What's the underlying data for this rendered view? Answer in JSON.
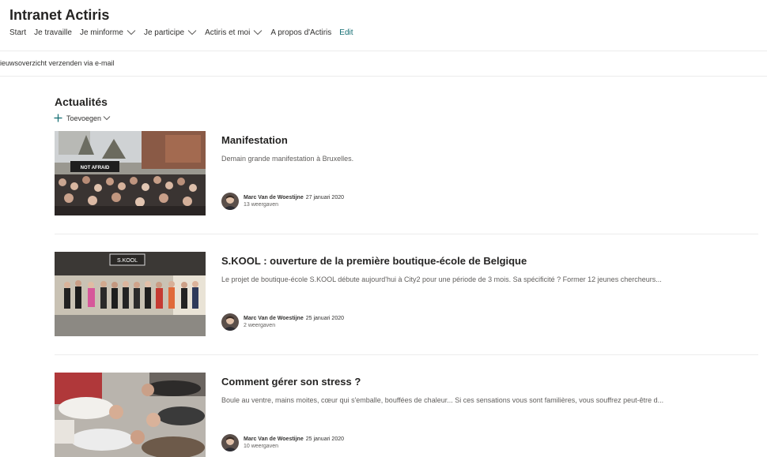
{
  "site": {
    "title": "Intranet Actiris"
  },
  "nav": {
    "items": [
      {
        "label": "Start"
      },
      {
        "label": "Je travaille"
      },
      {
        "label": "Je minforme"
      },
      {
        "label": "Je participe"
      },
      {
        "label": "Actiris et moi"
      },
      {
        "label": "A propos d'Actiris"
      }
    ],
    "edit_label": "Edit"
  },
  "commandbar": {
    "email_label": "ieuwsoverzicht verzenden via e-mail"
  },
  "news_section": {
    "title": "Actualités",
    "add_label": "Toevoegen",
    "items": [
      {
        "title": "Manifestation",
        "description": "Demain grande manifestation à Bruxelles.",
        "author": "Marc Van de Woestijne",
        "date": "27 januari 2020",
        "views": "13 weergaven",
        "image_text": "NOT AFRAID"
      },
      {
        "title": "S.KOOL : ouverture de la première boutique-école de Belgique",
        "description": "Le projet de boutique-école S.KOOL débute aujourd'hui à City2 pour une période de 3 mois. Sa spécificité ? Former 12 jeunes chercheurs...",
        "author": "Marc Van de Woestijne",
        "date": "25 januari 2020",
        "views": "2 weergaven",
        "image_text": "S.KOOL"
      },
      {
        "title": "Comment gérer son stress ?",
        "description": "Boule au ventre, mains moites, cœur qui s'emballe, bouffées de chaleur... Si ces sensations vous sont familières, vous souffrez peut-être d...",
        "author": "Marc Van de Woestijne",
        "date": "25 januari 2020",
        "views": "10 weergaven"
      }
    ]
  },
  "colors": {
    "accent": "#0f6b70",
    "text": "#323130",
    "muted": "#605e5c"
  }
}
